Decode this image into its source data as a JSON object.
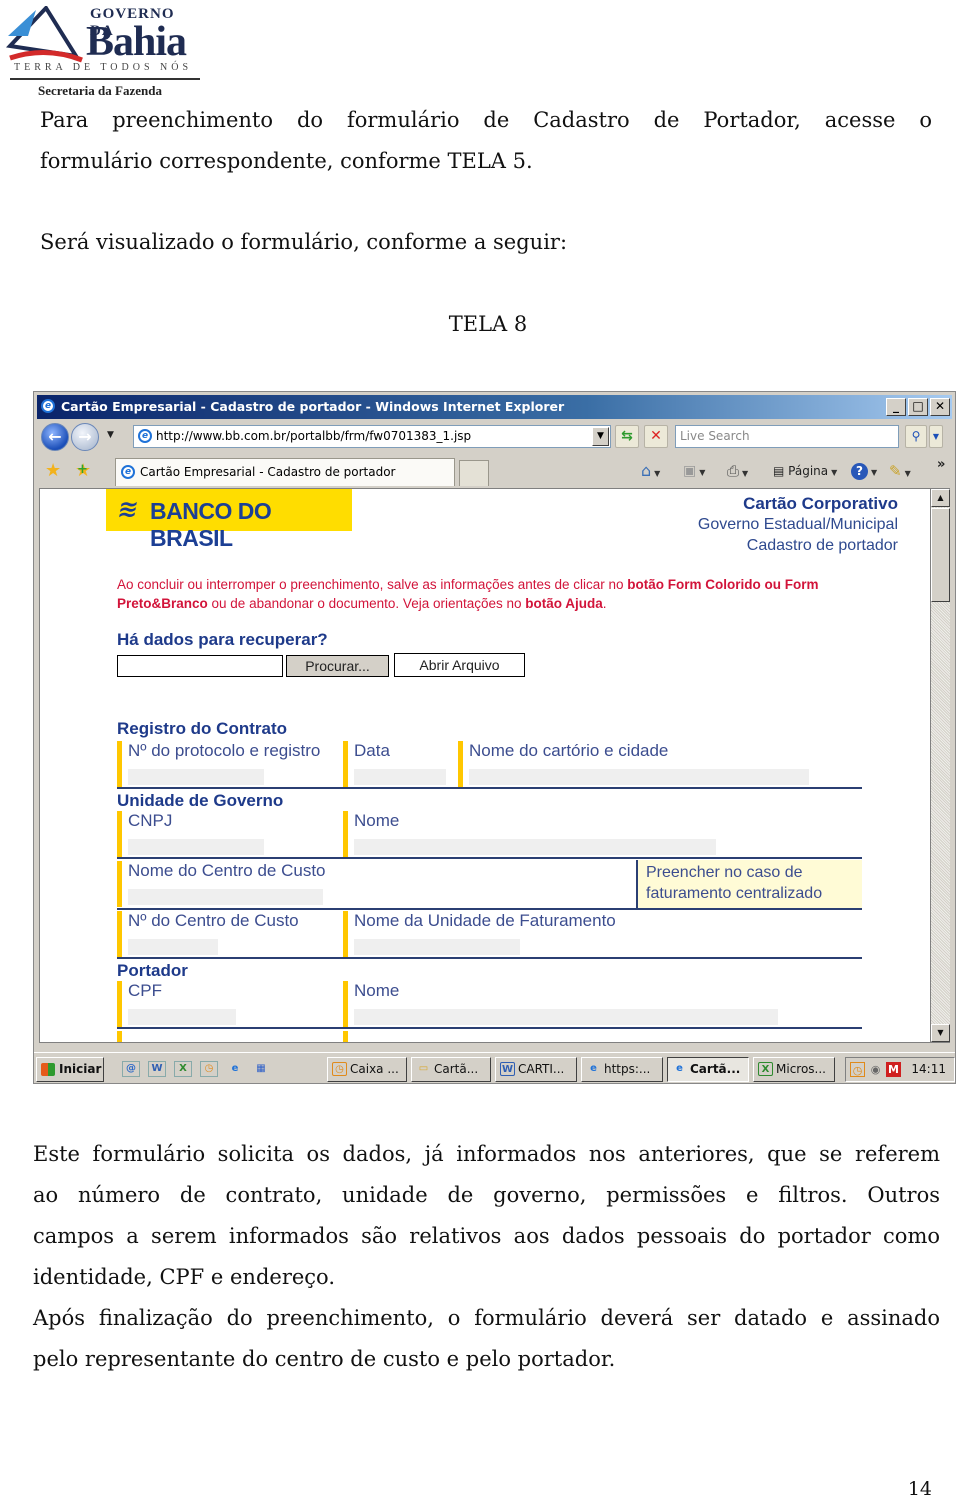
{
  "logo": {
    "line1": "GOVERNO DA",
    "line2": "Bahia",
    "tagline": "TERRA DE TODOS NÓS",
    "department": "Secretaria da Fazenda"
  },
  "doc": {
    "p1_line1": "Para preenchimento do formulário de Cadastro de Portador, acesse o",
    "p1_line2": "formulário correspondente, conforme TELA 5.",
    "p2": "Será visualizado o formulário, conforme a seguir:",
    "figure_caption": "TELA 8",
    "p3_lines": [
      "Este formulário solicita os dados, já informados nos anteriores, que se referem",
      "ao número de contrato, unidade de governo, permissões e filtros. Outros",
      "campos a serem informados são relativos aos dados pessoais do portador como",
      "identidade, CPF e endereço."
    ],
    "p4_lines": [
      "Após finalização do preenchimento, o formulário deverá ser datado e assinado",
      "pelo representante do centro de custo e pelo portador."
    ],
    "page_number": "14"
  },
  "browser": {
    "window_title": "Cartão Empresarial - Cadastro de portador - Windows Internet Explorer",
    "window_buttons": {
      "minimize": "_",
      "maximize": "□",
      "close": "✕"
    },
    "address_url": "http://www.bb.com.br/portalbb/frm/fw0701383_1.jsp",
    "search_placeholder": "Live Search",
    "tab_label": "Cartão Empresarial - Cadastro de portador",
    "command_bar": {
      "page_label": "Página",
      "more": "»"
    },
    "icons": {
      "back": "back-arrow-icon",
      "forward": "forward-arrow-icon",
      "refresh": "refresh-icon",
      "stop": "stop-icon",
      "search": "magnifier-icon",
      "favorites": "star-icon",
      "add_favorite": "add-star-icon",
      "home": "home-icon",
      "feeds": "rss-icon",
      "print": "printer-icon",
      "help": "help-icon",
      "tools": "pencil-icon"
    }
  },
  "form": {
    "bank_logo": "BANCO DO BRASIL",
    "header": {
      "line1": "Cartão Corporativo",
      "line2": "Governo Estadual/Municipal",
      "line3": "Cadastro de portador"
    },
    "warning": {
      "part1": "Ao concluir ou interromper o preenchimento, salve as informações antes de clicar no ",
      "bold1": "botão Form Colorido ou Form Preto&Branco",
      "part2": " ou de abandonar o documento. Veja orientações no ",
      "bold2": "botão Ajuda",
      "part3": "."
    },
    "recover": {
      "title": "Há dados para recuperar?",
      "file_value": "",
      "browse_button": "Procurar...",
      "open_button": "Abrir Arquivo"
    },
    "sections": {
      "contrato": {
        "title": "Registro do Contrato",
        "fields": [
          "Nº do protocolo e registro",
          "Data",
          "Nome do cartório e cidade"
        ]
      },
      "governo": {
        "title": "Unidade de Governo",
        "fields": [
          "CNPJ",
          "Nome",
          "Nome do Centro de Custo",
          "Nº do Centro de Custo",
          "Nome da Unidade de Faturamento"
        ],
        "note": "Preencher no caso de faturamento centralizado"
      },
      "portador": {
        "title": "Portador",
        "fields": [
          "CPF",
          "Nome"
        ]
      }
    }
  },
  "taskbar": {
    "start_label": "Iniciar",
    "quick_launch": [
      "outlook-icon",
      "word-icon",
      "excel-icon",
      "clock-icon",
      "ie-icon",
      "desktop-icon"
    ],
    "buttons": [
      {
        "label": "Caixa ...",
        "icon": "clock-icon",
        "active": false
      },
      {
        "label": "Cartã...",
        "icon": "folder-icon",
        "active": false
      },
      {
        "label": "CARTI...",
        "icon": "word-icon",
        "active": false
      },
      {
        "label": "https:...",
        "icon": "ie-icon",
        "active": false
      },
      {
        "label": "Cartã...",
        "icon": "ie-icon",
        "active": true
      },
      {
        "label": "Micros...",
        "icon": "excel-icon",
        "active": false
      }
    ],
    "clock": "14:11"
  }
}
